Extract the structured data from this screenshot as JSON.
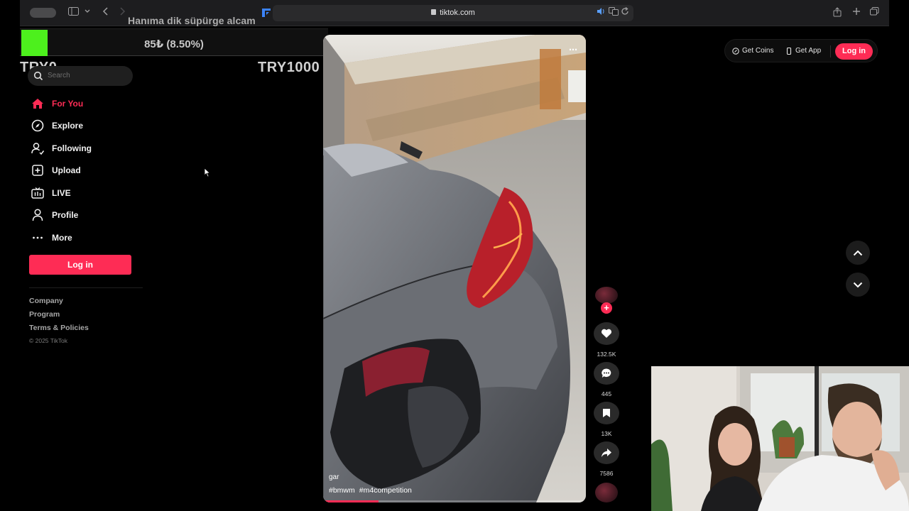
{
  "browser": {
    "url": "tiktok.com"
  },
  "overlay": {
    "donation_title": "Hanıma dik süpürge alcam",
    "donation_progress_text": "85₺ (8.50%)",
    "donation_progress": 0.085,
    "goal_min": "TRY0",
    "goal_max": "TRY1000",
    "goal_color": "#4df01d"
  },
  "sidebar": {
    "search_placeholder": "Search",
    "items": [
      {
        "label": "For You",
        "icon": "home-icon",
        "active": true
      },
      {
        "label": "Explore",
        "icon": "compass-icon",
        "active": false
      },
      {
        "label": "Following",
        "icon": "following-icon",
        "active": false
      },
      {
        "label": "Upload",
        "icon": "upload-icon",
        "active": false
      },
      {
        "label": "LIVE",
        "icon": "live-icon",
        "active": false
      },
      {
        "label": "Profile",
        "icon": "profile-icon",
        "active": false
      },
      {
        "label": "More",
        "icon": "more-icon",
        "active": false
      }
    ],
    "login_label": "Log in",
    "footer": {
      "company": "Company",
      "program": "Program",
      "terms": "Terms & Policies",
      "copyright": "© 2025 TikTok"
    }
  },
  "video": {
    "caption": "gar",
    "hashtags": [
      "#bmwm",
      "#m4competition"
    ],
    "progress": 0.21
  },
  "actions": {
    "likes": "132.5K",
    "comments": "445",
    "saves": "13K",
    "shares": "7586"
  },
  "header": {
    "get_coins": "Get Coins",
    "get_app": "Get App",
    "login_label": "Log in"
  },
  "colors": {
    "accent": "#fe2c55",
    "background": "#000000"
  }
}
